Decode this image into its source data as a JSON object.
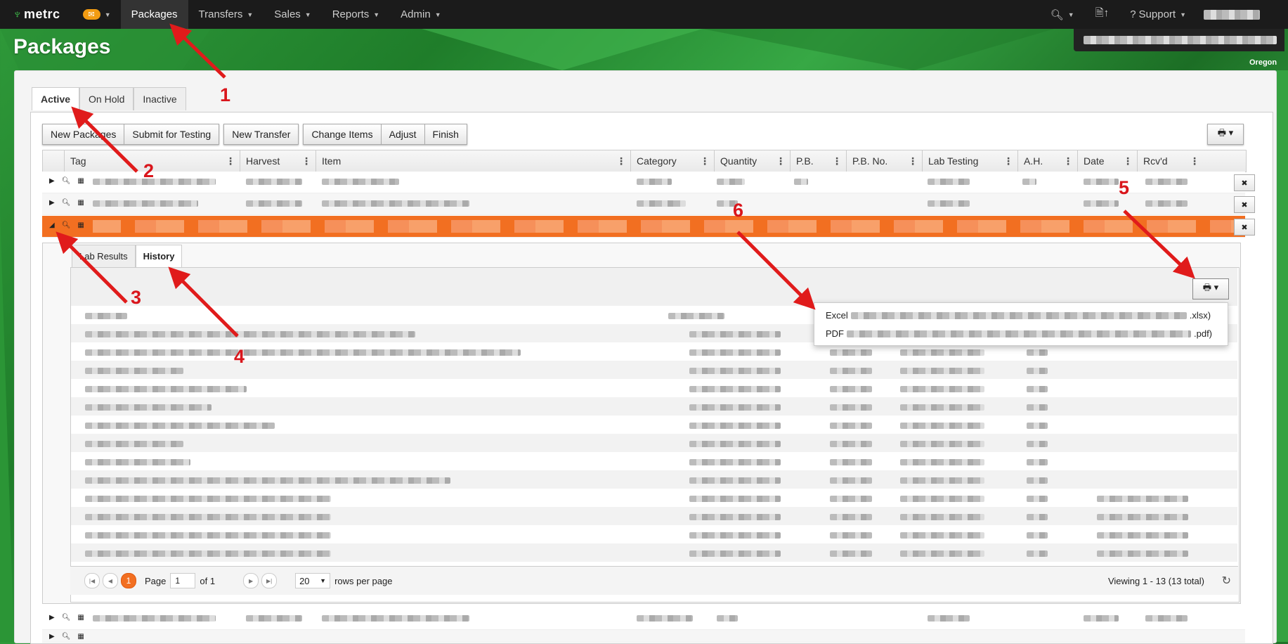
{
  "nav": {
    "brand": "metrc",
    "items": [
      "Packages",
      "Transfers",
      "Sales",
      "Reports",
      "Admin"
    ],
    "support": "Support"
  },
  "page": {
    "title": "Packages",
    "state": "Oregon"
  },
  "tabs": [
    "Active",
    "On Hold",
    "Inactive"
  ],
  "toolbar": {
    "new_packages": "New Packages",
    "submit_for_testing": "Submit for Testing",
    "new_transfer": "New Transfer",
    "change_items": "Change Items",
    "adjust": "Adjust",
    "finish": "Finish"
  },
  "columns": [
    "Tag",
    "Harvest",
    "Item",
    "Category",
    "Quantity",
    "P.B.",
    "P.B. No.",
    "Lab Testing",
    "A.H.",
    "Date",
    "Rcv'd"
  ],
  "detail_tabs": [
    "Lab Results",
    "History"
  ],
  "export_menu": {
    "excel_prefix": "Excel",
    "excel_suffix": ".xlsx)",
    "pdf_prefix": "PDF",
    "pdf_suffix": ".pdf)"
  },
  "pager": {
    "current_page": "1",
    "page_label": "Page",
    "of_label": "of 1",
    "rows_per_page": "20",
    "rows_label": "rows per page",
    "viewing": "Viewing 1 - 13 (13 total)"
  },
  "annotations": [
    "1",
    "2",
    "3",
    "4",
    "5",
    "6"
  ],
  "colors": {
    "accent": "#f26f21",
    "nav_bg": "#1b1b1b",
    "annotation": "#d9161c"
  }
}
